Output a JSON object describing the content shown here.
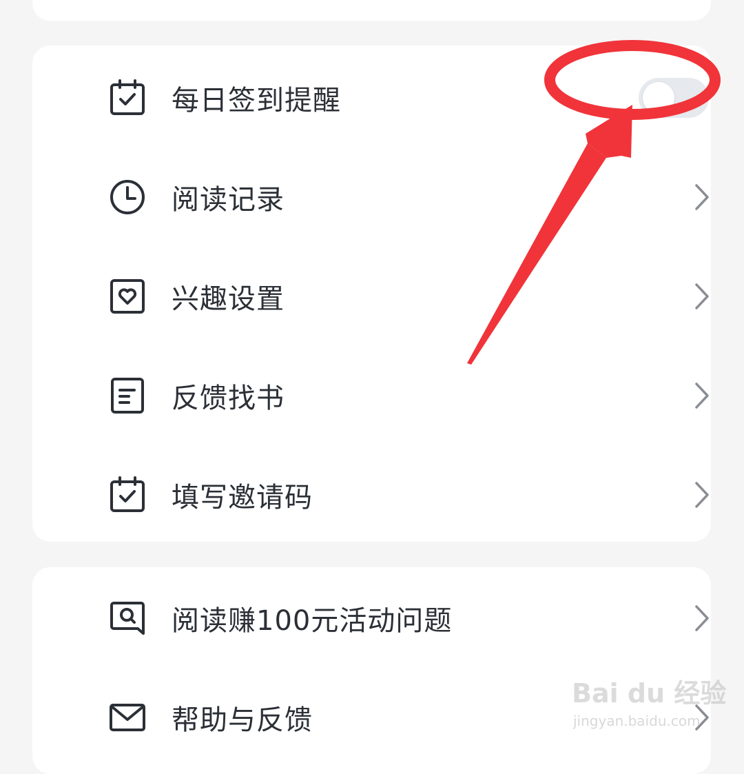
{
  "settings_group_1": {
    "items": [
      {
        "label": "每日签到提醒",
        "icon": "calendar-check-icon",
        "control": "toggle",
        "toggle_on": false
      },
      {
        "label": "阅读记录",
        "icon": "clock-icon",
        "control": "chevron"
      },
      {
        "label": "兴趣设置",
        "icon": "heart-square-icon",
        "control": "chevron"
      },
      {
        "label": "反馈找书",
        "icon": "document-icon",
        "control": "chevron"
      },
      {
        "label": "填写邀请码",
        "icon": "calendar-check-icon",
        "control": "chevron"
      }
    ]
  },
  "settings_group_2": {
    "items": [
      {
        "label": "阅读赚100元活动问题",
        "icon": "chat-search-icon",
        "control": "chevron"
      },
      {
        "label": "帮助与反馈",
        "icon": "mail-icon",
        "control": "chevron"
      }
    ]
  },
  "colors": {
    "background": "#f5f5f5",
    "card": "#ffffff",
    "text": "#2b2f36",
    "toggle_off": "#e6e9ee",
    "annotation": "#f0343a"
  },
  "watermark": {
    "logo": "Bai du 经验",
    "url": "jingyan.baidu.com"
  }
}
